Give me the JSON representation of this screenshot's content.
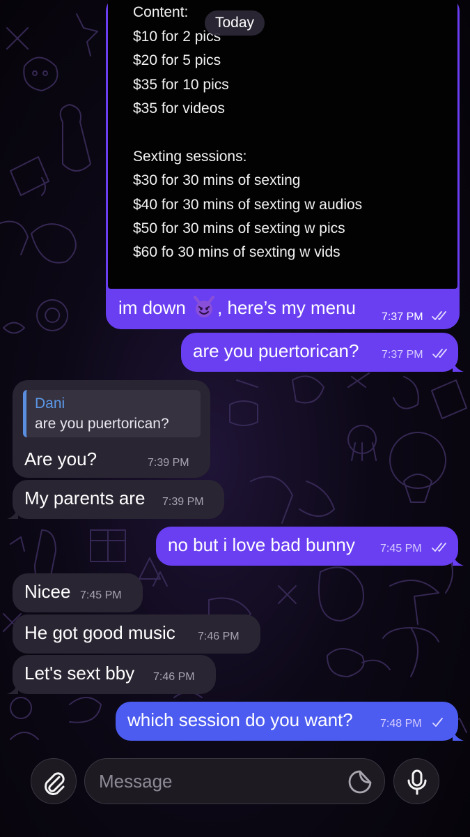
{
  "chat": {
    "date_pill": "Today",
    "media_message": {
      "menu_lines": [
        "Content:",
        "$10 for 2 pics",
        "$20 for 5 pics",
        "$35 for 10 pics",
        "$35 for videos",
        "Sexting sessions:",
        "$30 for 30 mins of sexting",
        "$40 for 30 mins of sexting w audios",
        "$50 for 30 mins of sexting w pics",
        "$60 fo 30 mins of sexting w vids"
      ],
      "caption_before": "im down",
      "caption_emoji": "smiling-face-with-horns-icon",
      "caption_after": ", here’s my menu",
      "time": "7:37 PM",
      "status": "read"
    },
    "messages": [
      {
        "direction": "out",
        "text": "are you puertorican?",
        "time": "7:37 PM",
        "status": "read"
      },
      {
        "direction": "in",
        "reply_to": {
          "name": "Dani",
          "text": "are you puertorican?"
        },
        "text": "Are you?",
        "time": "7:39 PM"
      },
      {
        "direction": "in",
        "text": "My parents are",
        "time": "7:39 PM"
      },
      {
        "direction": "out",
        "text": "no but i love bad bunny",
        "time": "7:45 PM",
        "status": "read"
      },
      {
        "direction": "in",
        "text": "Nicee",
        "time": "7:45 PM"
      },
      {
        "direction": "in",
        "text": "He got good music",
        "time": "7:46 PM"
      },
      {
        "direction": "in",
        "text": "Let's sext bby",
        "time": "7:46 PM"
      },
      {
        "direction": "out",
        "text": "which session do you want?",
        "time": "7:48 PM",
        "status": "sent"
      }
    ]
  },
  "composer": {
    "placeholder": "Message",
    "attach_icon": "paperclip-icon",
    "sticker_icon": "sticker-icon",
    "mic_icon": "microphone-icon"
  },
  "colors": {
    "outgoing_bubble": "#6a3ff2",
    "outgoing_bubble_latest": "#4c5cf0",
    "incoming_bubble": "#2a2532",
    "reply_accent": "#5c98e8"
  }
}
